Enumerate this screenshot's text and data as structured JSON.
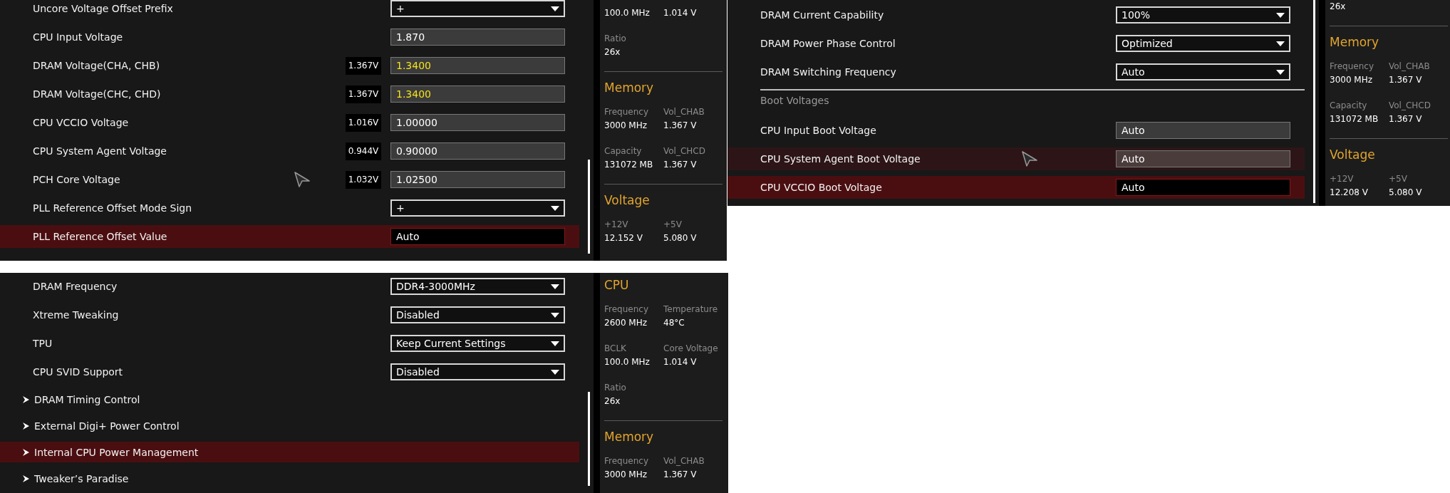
{
  "panels": [
    {
      "settings": [
        {
          "kind": "dropdown",
          "label": "Uncore Voltage Offset Prefix",
          "value": "+",
          "selected": false,
          "hovered": false,
          "pointer": false
        },
        {
          "kind": "field",
          "label": "CPU Input Voltage",
          "value": "1.870",
          "modified": false,
          "selected": false,
          "hovered": false,
          "pointer": false
        },
        {
          "kind": "field",
          "label": "DRAM Voltage(CHA, CHB)",
          "reading": "1.367V",
          "value": "1.3400",
          "modified": true,
          "selected": false,
          "hovered": false,
          "pointer": false
        },
        {
          "kind": "field",
          "label": "DRAM Voltage(CHC, CHD)",
          "reading": "1.367V",
          "value": "1.3400",
          "modified": true,
          "selected": false,
          "hovered": false,
          "pointer": false
        },
        {
          "kind": "field",
          "label": "CPU VCCIO Voltage",
          "reading": "1.016V",
          "value": "1.00000",
          "modified": false,
          "selected": false,
          "hovered": false,
          "pointer": false
        },
        {
          "kind": "field",
          "label": "CPU System Agent Voltage",
          "reading": "0.944V",
          "value": "0.90000",
          "modified": false,
          "selected": false,
          "hovered": false,
          "pointer": false
        },
        {
          "kind": "field",
          "label": "PCH Core Voltage",
          "reading": "1.032V",
          "value": "1.02500",
          "modified": false,
          "selected": false,
          "hovered": false,
          "pointer": true
        },
        {
          "kind": "dropdown",
          "label": "PLL Reference Offset Mode Sign",
          "value": "+",
          "selected": false,
          "hovered": false,
          "pointer": false
        },
        {
          "kind": "field",
          "label": "PLL Reference Offset Value",
          "value": "Auto",
          "modified": false,
          "selected": true,
          "hovered": false,
          "pointer": false
        }
      ],
      "sidebar": [
        {
          "items": [
            {
              "value": "100.0 MHz"
            },
            {
              "value": "1.014 V"
            },
            {
              "label": "Ratio",
              "value": "26x"
            }
          ]
        },
        {
          "title": "Memory",
          "items": [
            {
              "label": "Frequency",
              "value": "3000 MHz"
            },
            {
              "label": "Vol_CHAB",
              "value": "1.367 V"
            },
            {
              "label": "Capacity",
              "value": "131072 MB"
            },
            {
              "label": "Vol_CHCD",
              "value": "1.367 V"
            }
          ]
        },
        {
          "title": "Voltage",
          "items": [
            {
              "label": "+12V",
              "value": "12.152 V"
            },
            {
              "label": "+5V",
              "value": "5.080 V"
            }
          ]
        }
      ]
    },
    {
      "settings": [
        {
          "kind": "dropdown",
          "label": "DRAM Current Capability",
          "value": "100%",
          "selected": false,
          "hovered": false,
          "pointer": false
        },
        {
          "kind": "dropdown",
          "label": "DRAM Power Phase Control",
          "value": "Optimized",
          "selected": false,
          "hovered": false,
          "pointer": false
        },
        {
          "kind": "dropdown",
          "label": "DRAM Switching Frequency",
          "value": "Auto",
          "selected": false,
          "hovered": false,
          "pointer": false
        },
        {
          "kind": "heading",
          "label": "Boot Voltages"
        },
        {
          "kind": "field",
          "label": "CPU Input Boot Voltage",
          "value": "Auto",
          "modified": false,
          "selected": false,
          "hovered": false,
          "pointer": false
        },
        {
          "kind": "field",
          "label": "CPU System Agent Boot Voltage",
          "value": "Auto",
          "modified": false,
          "selected": false,
          "hovered": true,
          "pointer": true
        },
        {
          "kind": "field",
          "label": "CPU VCCIO Boot Voltage",
          "value": "Auto",
          "modified": false,
          "selected": true,
          "hovered": false,
          "pointer": false
        }
      ],
      "sidebar": [
        {
          "items": [
            {
              "value": "26x"
            }
          ]
        },
        {
          "title": "Memory",
          "items": [
            {
              "label": "Frequency",
              "value": "3000 MHz"
            },
            {
              "label": "Vol_CHAB",
              "value": "1.367 V"
            },
            {
              "label": "Capacity",
              "value": "131072 MB"
            },
            {
              "label": "Vol_CHCD",
              "value": "1.367 V"
            }
          ]
        },
        {
          "title": "Voltage",
          "items": [
            {
              "label": "+12V",
              "value": "12.208 V"
            },
            {
              "label": "+5V",
              "value": "5.080 V"
            }
          ]
        }
      ]
    },
    {
      "settings": [
        {
          "kind": "dropdown",
          "label": "DRAM Frequency",
          "value": "DDR4-3000MHz",
          "selected": false,
          "hovered": false,
          "pointer": false
        },
        {
          "kind": "dropdown",
          "label": "Xtreme Tweaking",
          "value": "Disabled",
          "selected": false,
          "hovered": false,
          "pointer": false
        },
        {
          "kind": "dropdown",
          "label": "TPU",
          "value": "Keep Current Settings",
          "selected": false,
          "hovered": false,
          "pointer": false
        },
        {
          "kind": "dropdown",
          "label": "CPU SVID Support",
          "value": "Disabled",
          "selected": false,
          "hovered": false,
          "pointer": false
        },
        {
          "kind": "submenu",
          "label": "DRAM Timing Control",
          "selected": false,
          "hovered": false,
          "pointer": false
        },
        {
          "kind": "submenu",
          "label": "External Digi+ Power Control",
          "selected": false,
          "hovered": false,
          "pointer": false
        },
        {
          "kind": "submenu",
          "label": "Internal CPU Power Management",
          "selected": true,
          "hovered": false,
          "pointer": false
        },
        {
          "kind": "submenu",
          "label": "Tweaker’s Paradise",
          "selected": false,
          "hovered": false,
          "pointer": false
        }
      ],
      "sidebar": [
        {
          "title": "CPU",
          "items": [
            {
              "label": "Frequency",
              "value": "2600 MHz"
            },
            {
              "label": "Temperature",
              "value": "48°C"
            },
            {
              "label": "BCLK",
              "value": "100.0 MHz"
            },
            {
              "label": "Core Voltage",
              "value": "1.014 V"
            },
            {
              "label": "Ratio",
              "value": "26x"
            }
          ]
        },
        {
          "title": "Memory",
          "items": [
            {
              "label": "Frequency",
              "value": "3000 MHz"
            },
            {
              "label": "Vol_CHAB",
              "value": "1.367 V"
            }
          ]
        }
      ]
    }
  ]
}
